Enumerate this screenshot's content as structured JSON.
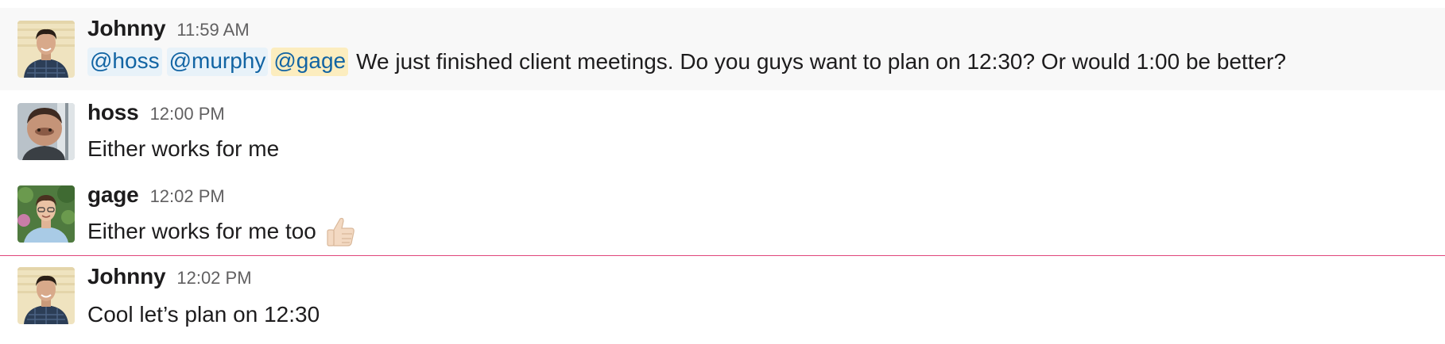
{
  "messages": [
    {
      "sender": "Johnny",
      "time": "11:59 AM",
      "mentions": [
        "@hoss",
        "@murphy",
        "@gage"
      ],
      "text": "We just finished client meetings. Do you guys want to plan on 12:30? Or would 1:00 be better?"
    },
    {
      "sender": "hoss",
      "time": "12:00 PM",
      "text": "Either works for me"
    },
    {
      "sender": "gage",
      "time": "12:02 PM",
      "text": "Either works for me too",
      "emoji": "thumbs-up"
    },
    {
      "sender": "Johnny",
      "time": "12:02 PM",
      "text": "Cool let’s plan on 12:30"
    }
  ],
  "colors": {
    "mention_text": "#1264a3",
    "mention_bg": "#e8f2f9",
    "self_mention_bg": "#fcedbf",
    "new_messages_divider": "#e0457b",
    "highlight_bg": "#f8f8f8"
  }
}
